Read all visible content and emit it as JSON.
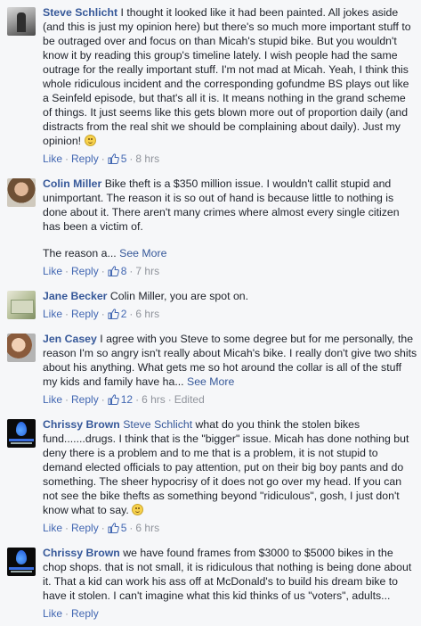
{
  "actions": {
    "like": "Like",
    "reply": "Reply",
    "sep": "·",
    "edited": "Edited"
  },
  "comments": [
    {
      "author": "Steve Schlicht",
      "text": "I thought it looked like it had been painted. All jokes aside (and this is just my opinion here) but there's so much more important stuff to be outraged over and focus on than Micah's stupid bike. But you wouldn't know it by reading this group's timeline lately. I wish people had the same outrage for the really important stuff. I'm not mad at Micah. Yeah, I think this whole ridiculous incident and the corresponding gofundme BS plays out like a Seinfeld episode, but that's all it is. It means nothing in the grand scheme of things. It just seems like this gets blown more out of proportion daily (and distracts from the real shit we should be complaining about daily). Just my opinion!",
      "likes": "5",
      "time": "8 hrs"
    },
    {
      "author": "Colin Miller",
      "text": "Bike theft is a $350 million issue. I wouldn't callit stupid and unimportant. The reason it is so out of hand is because little to nothing is done about it. There aren't many crimes where almost every single citizen has been a victim of.",
      "text2": "The reason a...",
      "see_more": "See More",
      "likes": "8",
      "time": "7 hrs"
    },
    {
      "author": "Jane Becker",
      "text": "Colin Miller, you are spot on.",
      "likes": "2",
      "time": "6 hrs"
    },
    {
      "author": "Jen Casey",
      "text": "I agree with you Steve to some degree but for me personally, the reason I'm so angry isn't really about Micah's bike. I really don't give two shits about his anything. What gets me so hot around the collar is all of the stuff my kids and family have ha...",
      "see_more": "See More",
      "likes": "12",
      "time": "6 hrs"
    },
    {
      "author": "Chrissy Brown",
      "mention": "Steve Schlicht",
      "text": "what do you think the stolen bikes fund.......drugs. I think that is the \"bigger\" issue. Micah has done nothing but deny there is a problem and to me that is a problem, it is not stupid to demand elected officials to pay attention, put on their big boy pants and do something. The sheer hypocrisy of it does not go over my head. If you can not see the bike thefts as something beyond \"ridiculous\", gosh, I just don't know what to say.",
      "likes": "5",
      "time": "6 hrs"
    },
    {
      "author": "Chrissy Brown",
      "text": "we have found frames from $3000 to $5000 bikes in the chop shops. that is not small, it is ridiculous that nothing is being done about it. That a kid can work his ass off at McDonald's to build his dream bike to have it stolen. I can't imagine what this kid thinks of us \"voters\", adults...",
      "likes": "",
      "time": ""
    }
  ]
}
